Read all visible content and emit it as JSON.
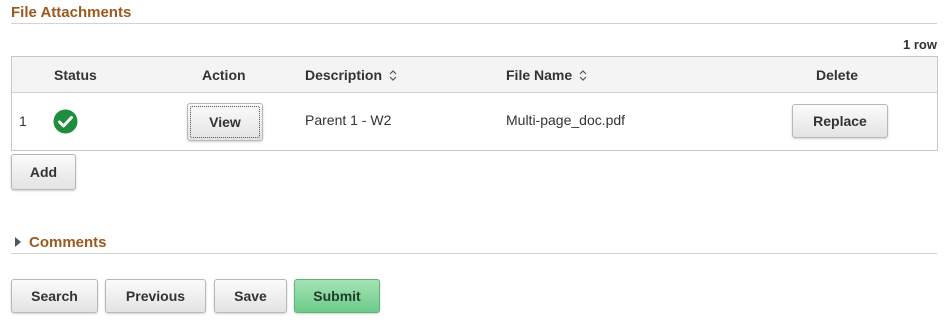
{
  "file_attachments": {
    "title": "File Attachments",
    "row_count": "1 row",
    "columns": {
      "status": "Status",
      "action": "Action",
      "description": "Description",
      "file_name": "File Name",
      "delete": "Delete"
    },
    "rows": [
      {
        "number": "1",
        "status_icon": "check-circle-icon",
        "status_color": "#1e8e3e",
        "action_label": "View",
        "description": "Parent 1 - W2",
        "file_name": "Multi-page_doc.pdf",
        "delete_label": "Replace"
      }
    ],
    "add_label": "Add"
  },
  "comments": {
    "title": "Comments",
    "expanded": false
  },
  "footer_buttons": {
    "search": "Search",
    "previous": "Previous",
    "save": "Save",
    "submit": "Submit"
  },
  "colors": {
    "section_title": "#9a5a1f",
    "primary_button": "#6ccb8a"
  }
}
